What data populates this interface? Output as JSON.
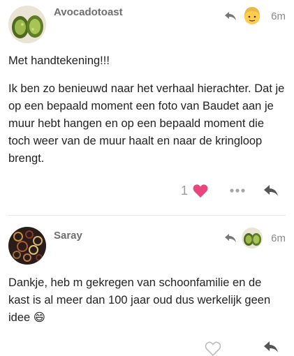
{
  "posts": [
    {
      "username": "Avocadotoast",
      "time": "6m",
      "paragraphs": [
        "Met handtekening!!!",
        "Ik ben zo benieuwd naar het verhaal hierachter. Dat je op een bepaald moment een foto van Baudet aan je muur hebt hangen en op een bepaald moment die toch weer van de muur haalt en naar de kringloop brengt."
      ],
      "like_count": "1"
    },
    {
      "username": "Saray",
      "time": "6m",
      "text": "Dankje, heb m gekregen van schoonfamilie en de kast is al meer dan 100 jaar oud dus werkelijk geen idee",
      "emoji": "😄"
    }
  ],
  "colors": {
    "heart": "#e8467c",
    "icon": "#666666",
    "muted": "#8a8a8a"
  }
}
